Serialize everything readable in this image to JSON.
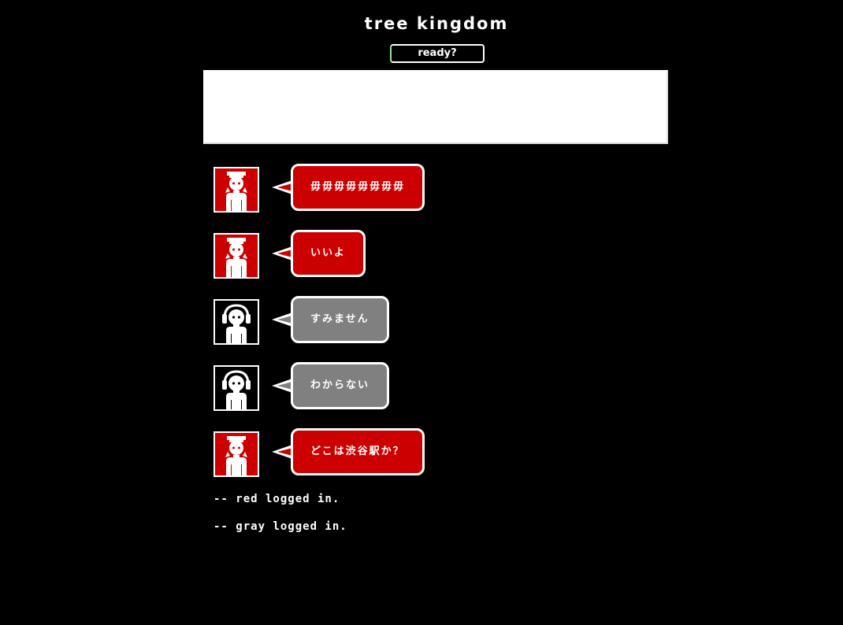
{
  "app": {
    "title": "tree kingdom",
    "ready_label": "ready?",
    "input_value": ""
  },
  "messages": [
    {
      "user": "red",
      "text": "毋毋毋毋毋毋毋毋"
    },
    {
      "user": "red",
      "text": "いいよ"
    },
    {
      "user": "gray",
      "text": "すみません"
    },
    {
      "user": "gray",
      "text": "わからない"
    },
    {
      "user": "red",
      "text": "どこは渋谷駅か？"
    }
  ],
  "system_messages": [
    "-- red logged in.",
    "-- gray logged in."
  ],
  "colors": {
    "background": "#000000",
    "red_user": "#cc0000",
    "gray_user": "#808080",
    "text": "#ffffff"
  },
  "icons": {
    "red_user_avatar": "girl-avatar-icon",
    "gray_user_avatar": "headphones-avatar-icon",
    "bubble_tail": "speech-tail-icon"
  }
}
